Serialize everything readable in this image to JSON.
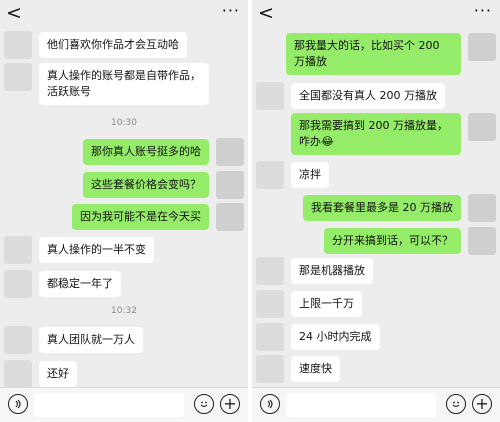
{
  "left": {
    "back_glyph": "<",
    "more_glyph": "···",
    "messages": [
      {
        "side": "received",
        "text": "他们喜欢你作品才会互动哈"
      },
      {
        "side": "received",
        "text": "真人操作的账号都是自带作品，活跃账号"
      },
      {
        "time": "10:30"
      },
      {
        "side": "sent",
        "text": "那你真人账号挺多的哈"
      },
      {
        "side": "sent",
        "text": "这些套餐价格会变吗？"
      },
      {
        "side": "sent",
        "text": "因为我可能不是在今天买"
      },
      {
        "side": "received",
        "text": "真人操作的一半不变"
      },
      {
        "side": "received",
        "text": "都稳定一年了"
      },
      {
        "time": "10:32"
      },
      {
        "side": "received",
        "text": "真人团队就一万人"
      },
      {
        "side": "received",
        "text": "还好"
      }
    ],
    "input": {
      "placeholder": ""
    }
  },
  "right": {
    "back_glyph": "<",
    "more_glyph": "···",
    "messages": [
      {
        "side": "sent",
        "text": "那我量大的话，比如买个 200 万播放"
      },
      {
        "side": "received",
        "text": "全国都没有真人 200 万播放"
      },
      {
        "side": "sent",
        "text": "那我需要搞到 200 万播放量，咋办😂"
      },
      {
        "side": "received",
        "text": "凉拌"
      },
      {
        "side": "sent",
        "text": "我看套餐里最多是 20 万播放"
      },
      {
        "side": "sent",
        "text": "分开来搞到话，可以不？"
      },
      {
        "side": "received",
        "text": "那是机器播放"
      },
      {
        "side": "received",
        "text": "上限一千万"
      },
      {
        "side": "received",
        "text": "24 小时内完成"
      },
      {
        "side": "received",
        "text": "速度快"
      }
    ],
    "input": {
      "placeholder": ""
    }
  },
  "colors": {
    "chat_bg": "#ededed",
    "sent_bubble": "#95ec69",
    "received_bubble": "#ffffff"
  },
  "icons": [
    "back-icon",
    "more-icon",
    "voice-icon",
    "emoji-icon",
    "plus-icon"
  ]
}
